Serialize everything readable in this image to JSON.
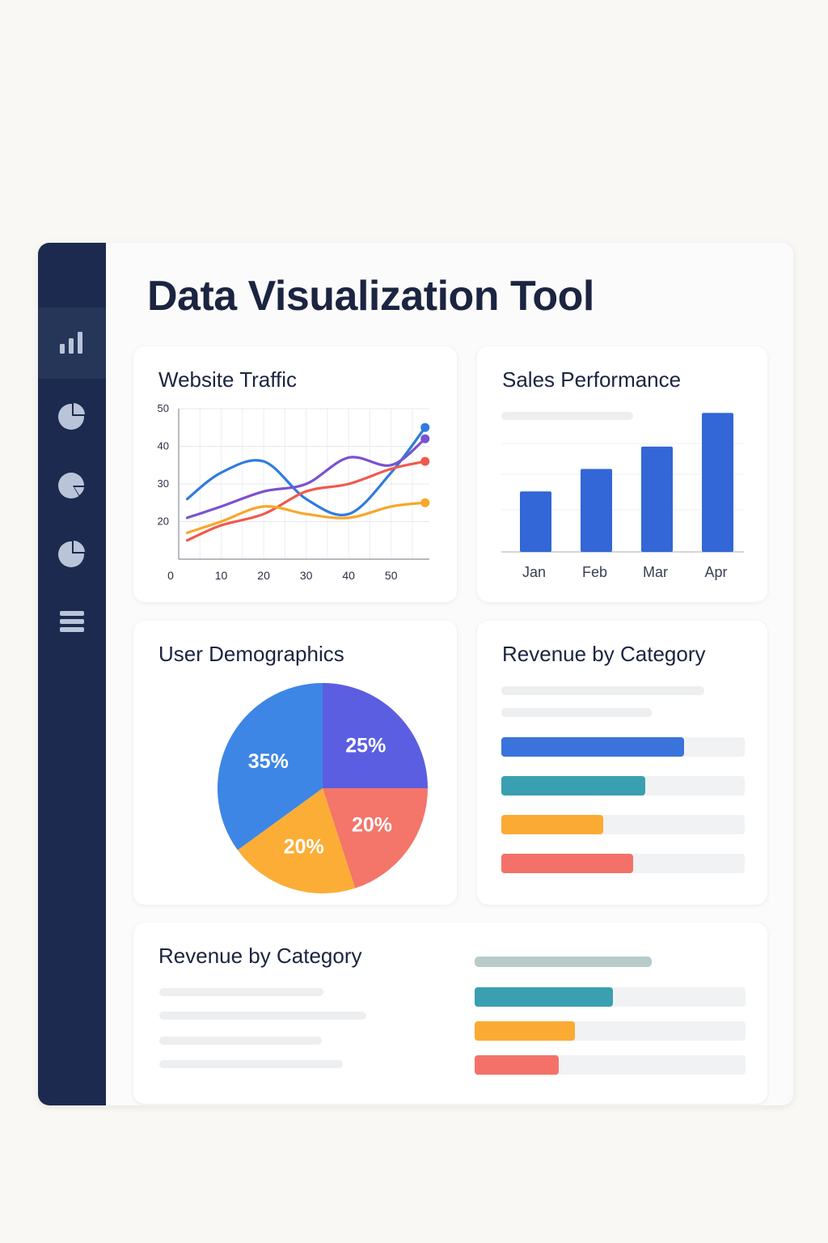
{
  "app": {
    "title": "Data Visualization Tool"
  },
  "sidebar": {
    "items": [
      {
        "icon": "bar-chart-icon",
        "active": true
      },
      {
        "icon": "pie-chart-icon",
        "active": false
      },
      {
        "icon": "pie-chart-icon",
        "active": false
      },
      {
        "icon": "pie-chart-icon",
        "active": false
      },
      {
        "icon": "menu-icon",
        "active": false
      }
    ]
  },
  "cards": {
    "traffic": {
      "title": "Website Traffic"
    },
    "sales": {
      "title": "Sales Performance"
    },
    "demographics": {
      "title": "User Demographics"
    },
    "revenue": {
      "title": "Revenue by Category"
    },
    "revenue_bottom": {
      "title": "Revenue by Category"
    }
  },
  "chart_data": [
    {
      "type": "line",
      "title": "Website Traffic",
      "x": [
        2,
        10,
        20,
        30,
        40,
        50,
        58
      ],
      "x_ticks": [
        "0",
        "10",
        "20",
        "30",
        "40",
        "50"
      ],
      "y_ticks": [
        "20",
        "30",
        "40",
        "50"
      ],
      "xlim": [
        0,
        59
      ],
      "ylim": [
        10,
        50
      ],
      "grid": true,
      "series": [
        {
          "color": "#2f7be0",
          "values": [
            26,
            33,
            36,
            26,
            22,
            33,
            45
          ]
        },
        {
          "color": "#7a52d1",
          "values": [
            21,
            24,
            28,
            30,
            37,
            35,
            42
          ]
        },
        {
          "color": "#f05a4e",
          "values": [
            15,
            19,
            22,
            28,
            30,
            34,
            36
          ]
        },
        {
          "color": "#f7a72a",
          "values": [
            17,
            20,
            24,
            22,
            21,
            24,
            25
          ]
        }
      ]
    },
    {
      "type": "bar",
      "title": "Sales Performance",
      "categories": [
        "Jan",
        "Feb",
        "Mar",
        "Apr"
      ],
      "values": [
        27,
        37,
        47,
        62
      ],
      "ylim": [
        0,
        65
      ],
      "color": "#3366d6",
      "grid": true
    },
    {
      "type": "pie",
      "title": "User Demographics",
      "slices": [
        {
          "label": "25%",
          "value": 25,
          "color": "#5b5ee0"
        },
        {
          "label": "20%",
          "value": 20,
          "color": "#f4756a"
        },
        {
          "label": "20%",
          "value": 20,
          "color": "#fbad36"
        },
        {
          "label": "35%",
          "value": 35,
          "color": "#3d86e6"
        }
      ]
    },
    {
      "type": "bar",
      "orientation": "horizontal",
      "title": "Revenue by Category",
      "values": [
        0.75,
        0.59,
        0.42,
        0.54
      ],
      "colors": [
        "#3a73db",
        "#3a9fb1",
        "#fbab33",
        "#f4716a"
      ],
      "xlim": [
        0,
        1
      ]
    },
    {
      "type": "bar",
      "orientation": "horizontal",
      "title": "Revenue by Category",
      "values": [
        0.51,
        0.37,
        0.31
      ],
      "colors": [
        "#3a9fb1",
        "#fbab33",
        "#f4716a"
      ],
      "xlim": [
        0,
        1
      ]
    }
  ]
}
